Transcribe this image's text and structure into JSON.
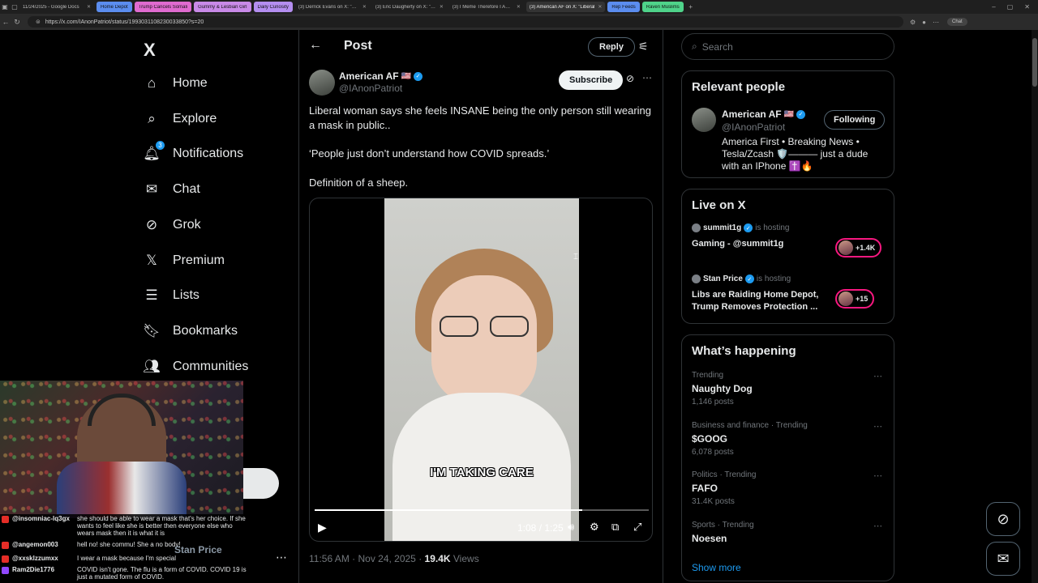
{
  "browser": {
    "tabs": [
      {
        "label": "11/24/2025 - Google Docs",
        "kind": "plain"
      },
      {
        "label": "Home Depot",
        "kind": "colored",
        "color": "#5b8def"
      },
      {
        "label": "Trump Cancels Somali",
        "kind": "colored",
        "color": "#e06bd0"
      },
      {
        "label": "Gummy & Lesbian Girl",
        "kind": "colored",
        "color": "#c98ae8"
      },
      {
        "label": "Daily Curiosity",
        "kind": "colored",
        "color": "#b48ef0"
      },
      {
        "label": "(3) Derrick Evans on X: \"Black wo",
        "kind": "plain"
      },
      {
        "label": "(3) Eric Daugherty on X: \"BR",
        "kind": "plain"
      },
      {
        "label": "(3) I Meme Therefore I Am on",
        "kind": "plain"
      },
      {
        "label": "(3) American AF on X: \"Liberal",
        "kind": "active"
      },
      {
        "label": "Rep Feeds",
        "kind": "colored",
        "color": "#5b8def"
      },
      {
        "label": "Raven Muslims",
        "kind": "colored",
        "color": "#4fd38a"
      }
    ],
    "url": "https://x.com/IAnonPatriot/status/1993031108230033850?s=20",
    "chat_label": "Chat"
  },
  "nav": {
    "logo": "X",
    "items": [
      {
        "label": "Home",
        "icon": "⌂",
        "name": "home"
      },
      {
        "label": "Explore",
        "icon": "⌕",
        "name": "explore"
      },
      {
        "label": "Notifications",
        "icon": "🔔︎",
        "name": "notifications",
        "badge": "3"
      },
      {
        "label": "Chat",
        "icon": "✉",
        "name": "chat"
      },
      {
        "label": "Grok",
        "icon": "⊘",
        "name": "grok"
      },
      {
        "label": "Premium",
        "icon": "𝕏",
        "name": "premium"
      },
      {
        "label": "Lists",
        "icon": "☰",
        "name": "lists"
      },
      {
        "label": "Bookmarks",
        "icon": "🔖︎",
        "name": "bookmarks"
      },
      {
        "label": "Communities",
        "icon": "👥︎",
        "name": "communities"
      }
    ]
  },
  "chat": {
    "lines": [
      {
        "user": "@insomniac-lq3gx",
        "msg": "she should be able to wear a mask that's her choice. If she wants to feel like she is better then everyone else who wears mask then it is what it is",
        "color": "red"
      },
      {
        "user": "@angemon003",
        "msg": "hell no! she commu! She a no body!",
        "color": "red"
      },
      {
        "user": "@xxsklzzumxx",
        "msg": "I wear a mask because I'm special",
        "color": "red"
      },
      {
        "user": "Ram2Die1776",
        "msg": "COVID isn't gone. The flu is a form of COVID. COVID 19 is just a mutated form of COVID.",
        "color": "purple"
      }
    ],
    "behind_text": "Stan Price"
  },
  "post": {
    "header_title": "Post",
    "reply_label": "Reply",
    "author_name": "American AF",
    "author_flag": "🇺🇸",
    "author_handle": "@IAnonPatriot",
    "subscribe_label": "Subscribe",
    "text_paragraphs": [
      "Liberal woman says she feels INSANE being the only person still wearing a mask in public..",
      "‘People just don’t understand how COVID spreads.’",
      "Definition of a sheep."
    ],
    "video": {
      "caption": "I'M TAKING CARE",
      "timecode": "1:08 / 1:25",
      "progress": 0.8
    },
    "meta": {
      "time": "11:56 AM · Nov 24, 2025 · ",
      "views": "19.4K",
      "views_label": " Views"
    }
  },
  "search": {
    "placeholder": "Search"
  },
  "relevant": {
    "title": "Relevant people",
    "name": "American AF",
    "flag": "🇺🇸",
    "handle": "@IAnonPatriot",
    "follow_label": "Following",
    "bio": "America First • Breaking News • Tesla/Zcash 🛡️——— just a dude with an IPhone ✝️🔥"
  },
  "live": {
    "title": "Live on X",
    "items": [
      {
        "host": "summit1g",
        "hosting": "is hosting",
        "title": "Gaming - @summit1g",
        "count": "+1.4K"
      },
      {
        "host": "Stan Price",
        "hosting": "is hosting",
        "title": "Libs are Raiding Home Depot, Trump Removes Protection ...",
        "count": "+15"
      }
    ]
  },
  "happening": {
    "title": "What’s happening",
    "trends": [
      {
        "context": "Trending",
        "name": "Naughty Dog",
        "posts": "1,146 posts"
      },
      {
        "context": "Business and finance · Trending",
        "name": "$GOOG",
        "posts": "6,078 posts"
      },
      {
        "context": "Politics · Trending",
        "name": "FAFO",
        "posts": "31.4K posts"
      },
      {
        "context": "Sports · Trending",
        "name": "Noesen",
        "posts": ""
      }
    ],
    "show_more": "Show more"
  }
}
